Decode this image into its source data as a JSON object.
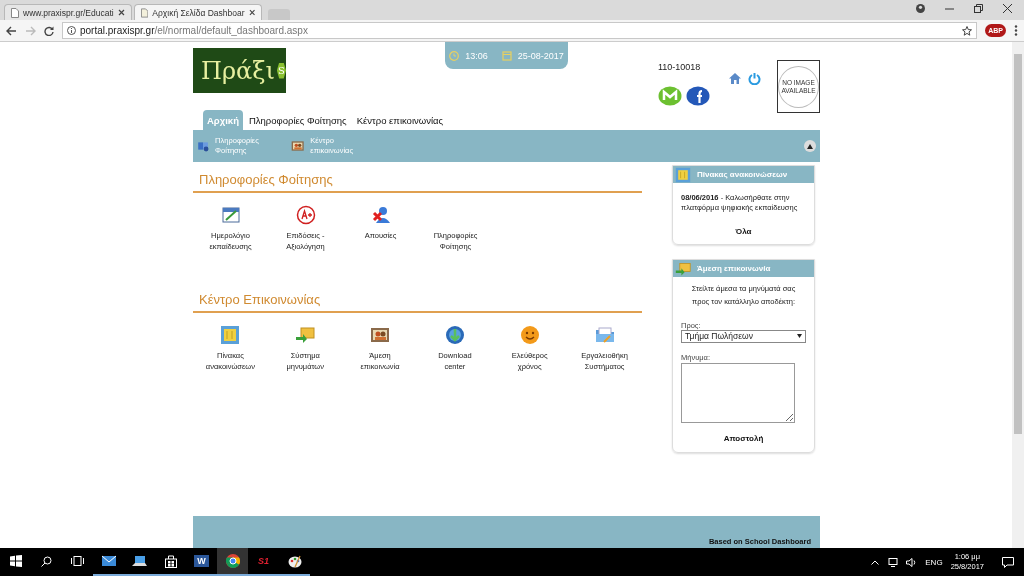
{
  "browser": {
    "tabs": [
      {
        "title": "www.praxispr.gr/Educati",
        "selected": false
      },
      {
        "title": "Αρχική Σελίδα Dashboar",
        "selected": true
      }
    ],
    "url_host": "portal.praxispr.gr",
    "url_path": "/el/normal/default_dashboard.aspx",
    "extension": "ABP"
  },
  "header": {
    "logo_text": "Πράξι",
    "logo_badge": "S",
    "time": "13:06",
    "date": "25-08-2017",
    "user_code": "110-10018",
    "photo_text": "NO IMAGE AVAILABLE"
  },
  "nav_tabs": [
    {
      "label": "Αρχική",
      "selected": true
    },
    {
      "label": "Πληροφορίες Φοίτησης",
      "selected": false
    },
    {
      "label": "Κέντρο επικοινωνίας",
      "selected": false
    }
  ],
  "subnav": [
    {
      "label": "Πληροφορίες Φοίτησης",
      "kind": "book"
    },
    {
      "label": "Κέντρο επικοινωνίας",
      "kind": "contact"
    }
  ],
  "sections": [
    {
      "title": "Πληροφορίες Φοίτησης",
      "items": [
        {
          "label": "Ημερολόγιο εκπαίδευσης",
          "kind": "calendar"
        },
        {
          "label": "Επιδόσεις - Αξιολόγηση",
          "kind": "grade"
        },
        {
          "label": "Απουσίες",
          "kind": "absences"
        },
        {
          "label": "Πληροφορίες Φοίτησης",
          "kind": "text"
        }
      ]
    },
    {
      "title": "Κέντρο Επικοινωνίας",
      "items": [
        {
          "label": "Πίνακας ανακοινώσεων",
          "kind": "board"
        },
        {
          "label": "Σύστημα μηνυμάτων",
          "kind": "messages"
        },
        {
          "label": "Άμεση επικοινωνία",
          "kind": "contact"
        },
        {
          "label": "Download center",
          "kind": "download"
        },
        {
          "label": "Ελεύθερος χρόνος",
          "kind": "smiley"
        },
        {
          "label": "Εργαλειοθήκη Συστήματος",
          "kind": "folder"
        }
      ]
    }
  ],
  "announcements": {
    "title": "Πίνακας ανακοινώσεων",
    "items": [
      "**08/06/2016** - Καλωσήρθατε στην πλατφόρμα ψηφιακής εκπαίδευσης"
    ],
    "link": "Όλα"
  },
  "contact": {
    "title": "Άμεση επικοινωνία",
    "intro": "Στείλτε άμεσα τα μηνύματά σας προς τον κατάλληλο αποδέκτη:",
    "to_label": "Προς:",
    "to_value": "Τμήμα Πωλήσεων",
    "message_label": "Μήνυμα:",
    "submit": "Αποστολή"
  },
  "footer": "Based on School Dashboard",
  "taskbar": {
    "apps": [
      {
        "kind": "mail"
      },
      {
        "kind": "laptop"
      },
      {
        "kind": "store"
      },
      {
        "kind": "word",
        "label": "W"
      },
      {
        "kind": "chrome",
        "selected": true
      },
      {
        "kind": "s1",
        "label": "S1"
      },
      {
        "kind": "paint"
      }
    ],
    "lang": "ENG",
    "time": "1:06 μμ",
    "date": "25/8/2017"
  }
}
